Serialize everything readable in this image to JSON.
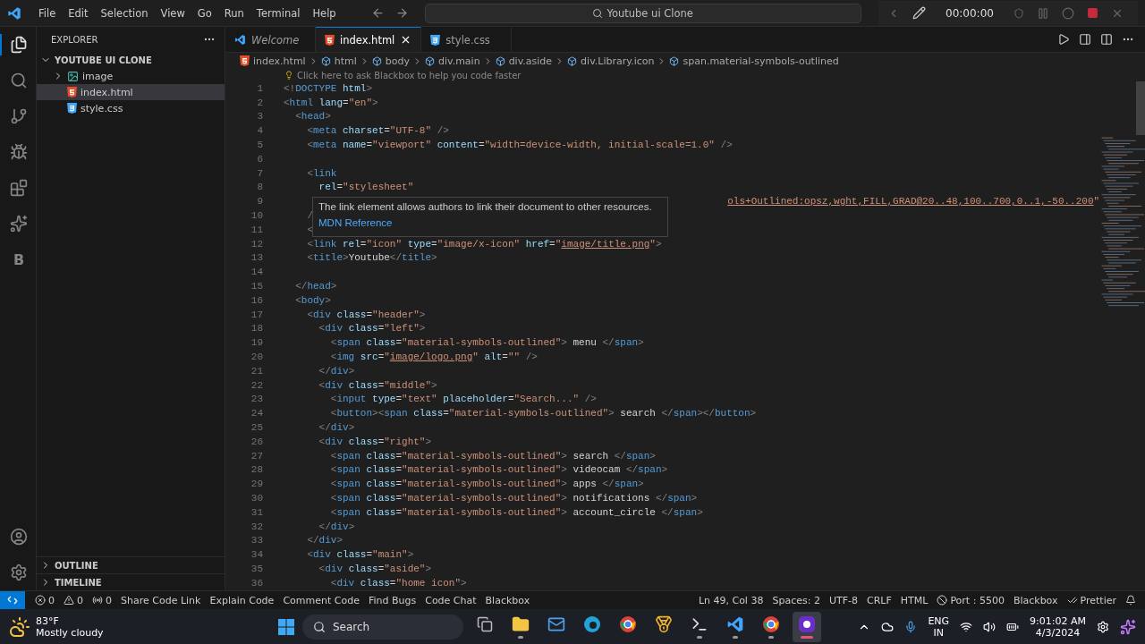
{
  "title_bar": {
    "menu": [
      "File",
      "Edit",
      "Selection",
      "View",
      "Go",
      "Run",
      "Terminal",
      "Help"
    ],
    "command_center": "Youtube ui Clone",
    "recorder": {
      "time": "00:00:00"
    }
  },
  "activity_bar": {
    "items": [
      {
        "kind": "explorer",
        "selected": true
      },
      {
        "kind": "search",
        "selected": false
      },
      {
        "kind": "scm",
        "selected": false
      },
      {
        "kind": "debug",
        "selected": false
      },
      {
        "kind": "extensions",
        "selected": false
      },
      {
        "kind": "ai",
        "selected": false
      },
      {
        "kind": "blackbox",
        "glyph": "B",
        "selected": false
      }
    ],
    "bottom": [
      {
        "kind": "account"
      },
      {
        "kind": "settings"
      }
    ]
  },
  "sidebar": {
    "title": "EXPLORER",
    "tree": [
      {
        "label": "YOUTUBE UI CLONE",
        "kind": "root",
        "expanded": true,
        "selected": false,
        "children": [
          {
            "label": "image",
            "kind": "folder",
            "expanded": false,
            "selected": false
          },
          {
            "label": "index.html",
            "kind": "html",
            "selected": true
          },
          {
            "label": "style.css",
            "kind": "css",
            "selected": false
          }
        ]
      }
    ],
    "sections": [
      {
        "label": "OUTLINE",
        "expanded": false
      },
      {
        "label": "TIMELINE",
        "expanded": false
      }
    ]
  },
  "tabs": [
    {
      "label": "Welcome",
      "kind": "welcome",
      "preview": true,
      "selected": false
    },
    {
      "label": "index.html",
      "kind": "html",
      "preview": false,
      "selected": true
    },
    {
      "label": "style.css",
      "kind": "css",
      "preview": false,
      "selected": false
    }
  ],
  "breadcrumb": [
    {
      "kind": "html",
      "label": "index.html"
    },
    {
      "kind": "element",
      "label": "html"
    },
    {
      "kind": "element",
      "label": "body"
    },
    {
      "kind": "element",
      "label": "div.main"
    },
    {
      "kind": "element",
      "label": "div.aside"
    },
    {
      "kind": "element",
      "label": "div.Library.icon"
    },
    {
      "kind": "element",
      "label": "span.material-symbols-outlined"
    }
  ],
  "hint": "Click here to ask Blackbox to help you code faster",
  "code": [
    {
      "n": "1",
      "tokens": [
        {
          "kind": "p",
          "text": "<!"
        },
        {
          "kind": "tag",
          "text": "DOCTYPE"
        },
        {
          "kind": "attr",
          "text": " html"
        },
        {
          "kind": "p",
          "text": ">"
        }
      ]
    },
    {
      "n": "2",
      "tokens": [
        {
          "kind": "p",
          "text": "<"
        },
        {
          "kind": "tag",
          "text": "html"
        },
        {
          "kind": "attr",
          "text": " lang"
        },
        {
          "kind": "txt",
          "text": "="
        },
        {
          "kind": "str",
          "text": "\"en\""
        },
        {
          "kind": "p",
          "text": ">"
        }
      ]
    },
    {
      "n": "3",
      "tokens": [
        {
          "kind": "p",
          "text": "  <"
        },
        {
          "kind": "tag",
          "text": "head"
        },
        {
          "kind": "p",
          "text": ">"
        }
      ]
    },
    {
      "n": "4",
      "tokens": [
        {
          "kind": "p",
          "text": "    <"
        },
        {
          "kind": "tag",
          "text": "meta"
        },
        {
          "kind": "attr",
          "text": " charset"
        },
        {
          "kind": "txt",
          "text": "="
        },
        {
          "kind": "str",
          "text": "\"UTF-8\""
        },
        {
          "kind": "p",
          "text": " />"
        }
      ]
    },
    {
      "n": "5",
      "tokens": [
        {
          "kind": "p",
          "text": "    <"
        },
        {
          "kind": "tag",
          "text": "meta"
        },
        {
          "kind": "attr",
          "text": " name"
        },
        {
          "kind": "txt",
          "text": "="
        },
        {
          "kind": "str",
          "text": "\"viewport\""
        },
        {
          "kind": "attr",
          "text": " content"
        },
        {
          "kind": "txt",
          "text": "="
        },
        {
          "kind": "str",
          "text": "\"width=device-width, initial-scale=1.0\""
        },
        {
          "kind": "p",
          "text": " />"
        }
      ]
    },
    {
      "n": "6"
    },
    {
      "n": "7",
      "tokens": [
        {
          "kind": "p",
          "text": "    <"
        },
        {
          "kind": "tag",
          "text": "link"
        }
      ]
    },
    {
      "n": "8",
      "tokens": [
        {
          "kind": "attr",
          "text": "      rel"
        },
        {
          "kind": "txt",
          "text": "="
        },
        {
          "kind": "str",
          "text": "\"stylesheet\""
        }
      ]
    },
    {
      "n": "9",
      "kind": "covered",
      "tokens": [
        {
          "kind": "link",
          "text": "ols+Outlined:opsz,wght,FILL,GRAD@20..48,100..700,0..1,-50..200"
        },
        {
          "kind": "str",
          "text": "\""
        }
      ]
    },
    {
      "n": "10",
      "tokens": [
        {
          "kind": "p",
          "text": "    /"
        }
      ]
    },
    {
      "n": "11",
      "tokens": [
        {
          "kind": "p",
          "text": "    <"
        }
      ]
    },
    {
      "n": "12",
      "tokens": [
        {
          "kind": "p",
          "text": "    <"
        },
        {
          "kind": "tag",
          "text": "link"
        },
        {
          "kind": "attr",
          "text": " rel"
        },
        {
          "kind": "txt",
          "text": "="
        },
        {
          "kind": "str",
          "text": "\"icon\""
        },
        {
          "kind": "attr",
          "text": " type"
        },
        {
          "kind": "txt",
          "text": "="
        },
        {
          "kind": "str",
          "text": "\"image/x-icon\""
        },
        {
          "kind": "attr",
          "text": " href"
        },
        {
          "kind": "txt",
          "text": "="
        },
        {
          "kind": "str",
          "text": "\""
        },
        {
          "kind": "link",
          "text": "image/title.png"
        },
        {
          "kind": "str",
          "text": "\""
        },
        {
          "kind": "p",
          "text": ">"
        }
      ]
    },
    {
      "n": "13",
      "tokens": [
        {
          "kind": "p",
          "text": "    <"
        },
        {
          "kind": "tag",
          "text": "title"
        },
        {
          "kind": "p",
          "text": ">"
        },
        {
          "kind": "txt",
          "text": "Youtube"
        },
        {
          "kind": "p",
          "text": "</"
        },
        {
          "kind": "tag",
          "text": "title"
        },
        {
          "kind": "p",
          "text": ">"
        }
      ]
    },
    {
      "n": "14"
    },
    {
      "n": "15",
      "tokens": [
        {
          "kind": "p",
          "text": "  </"
        },
        {
          "kind": "tag",
          "text": "head"
        },
        {
          "kind": "p",
          "text": ">"
        }
      ]
    },
    {
      "n": "16",
      "tokens": [
        {
          "kind": "p",
          "text": "  <"
        },
        {
          "kind": "tag",
          "text": "body"
        },
        {
          "kind": "p",
          "text": ">"
        }
      ]
    },
    {
      "n": "17",
      "tokens": [
        {
          "kind": "p",
          "text": "    <"
        },
        {
          "kind": "tag",
          "text": "div"
        },
        {
          "kind": "attr",
          "text": " class"
        },
        {
          "kind": "txt",
          "text": "="
        },
        {
          "kind": "str",
          "text": "\"header\""
        },
        {
          "kind": "p",
          "text": ">"
        }
      ]
    },
    {
      "n": "18",
      "tokens": [
        {
          "kind": "p",
          "text": "      <"
        },
        {
          "kind": "tag",
          "text": "div"
        },
        {
          "kind": "attr",
          "text": " class"
        },
        {
          "kind": "txt",
          "text": "="
        },
        {
          "kind": "str",
          "text": "\"left\""
        },
        {
          "kind": "p",
          "text": ">"
        }
      ]
    },
    {
      "n": "19",
      "tokens": [
        {
          "kind": "p",
          "text": "        <"
        },
        {
          "kind": "tag",
          "text": "span"
        },
        {
          "kind": "attr",
          "text": " class"
        },
        {
          "kind": "txt",
          "text": "="
        },
        {
          "kind": "str",
          "text": "\"material-symbols-outlined\""
        },
        {
          "kind": "p",
          "text": ">"
        },
        {
          "kind": "txt",
          "text": " menu "
        },
        {
          "kind": "p",
          "text": "</"
        },
        {
          "kind": "tag",
          "text": "span"
        },
        {
          "kind": "p",
          "text": ">"
        }
      ]
    },
    {
      "n": "20",
      "tokens": [
        {
          "kind": "p",
          "text": "        <"
        },
        {
          "kind": "tag",
          "text": "img"
        },
        {
          "kind": "attr",
          "text": " src"
        },
        {
          "kind": "txt",
          "text": "="
        },
        {
          "kind": "str",
          "text": "\""
        },
        {
          "kind": "link",
          "text": "image/logo.png"
        },
        {
          "kind": "str",
          "text": "\""
        },
        {
          "kind": "attr",
          "text": " alt"
        },
        {
          "kind": "txt",
          "text": "="
        },
        {
          "kind": "str",
          "text": "\"\""
        },
        {
          "kind": "p",
          "text": " />"
        }
      ]
    },
    {
      "n": "21",
      "tokens": [
        {
          "kind": "p",
          "text": "      </"
        },
        {
          "kind": "tag",
          "text": "div"
        },
        {
          "kind": "p",
          "text": ">"
        }
      ]
    },
    {
      "n": "22",
      "tokens": [
        {
          "kind": "p",
          "text": "      <"
        },
        {
          "kind": "tag",
          "text": "div"
        },
        {
          "kind": "attr",
          "text": " class"
        },
        {
          "kind": "txt",
          "text": "="
        },
        {
          "kind": "str",
          "text": "\"middle\""
        },
        {
          "kind": "p",
          "text": ">"
        }
      ]
    },
    {
      "n": "23",
      "tokens": [
        {
          "kind": "p",
          "text": "        <"
        },
        {
          "kind": "tag",
          "text": "input"
        },
        {
          "kind": "attr",
          "text": " type"
        },
        {
          "kind": "txt",
          "text": "="
        },
        {
          "kind": "str",
          "text": "\"text\""
        },
        {
          "kind": "attr",
          "text": " placeholder"
        },
        {
          "kind": "txt",
          "text": "="
        },
        {
          "kind": "str",
          "text": "\"Search...\""
        },
        {
          "kind": "p",
          "text": " />"
        }
      ]
    },
    {
      "n": "24",
      "tokens": [
        {
          "kind": "p",
          "text": "        <"
        },
        {
          "kind": "tag",
          "text": "button"
        },
        {
          "kind": "p",
          "text": "><"
        },
        {
          "kind": "tag",
          "text": "span"
        },
        {
          "kind": "attr",
          "text": " class"
        },
        {
          "kind": "txt",
          "text": "="
        },
        {
          "kind": "str",
          "text": "\"material-symbols-outlined\""
        },
        {
          "kind": "p",
          "text": ">"
        },
        {
          "kind": "txt",
          "text": " search "
        },
        {
          "kind": "p",
          "text": "</"
        },
        {
          "kind": "tag",
          "text": "span"
        },
        {
          "kind": "p",
          "text": "></"
        },
        {
          "kind": "tag",
          "text": "button"
        },
        {
          "kind": "p",
          "text": ">"
        }
      ]
    },
    {
      "n": "25",
      "tokens": [
        {
          "kind": "p",
          "text": "      </"
        },
        {
          "kind": "tag",
          "text": "div"
        },
        {
          "kind": "p",
          "text": ">"
        }
      ]
    },
    {
      "n": "26",
      "tokens": [
        {
          "kind": "p",
          "text": "      <"
        },
        {
          "kind": "tag",
          "text": "div"
        },
        {
          "kind": "attr",
          "text": " class"
        },
        {
          "kind": "txt",
          "text": "="
        },
        {
          "kind": "str",
          "text": "\"right\""
        },
        {
          "kind": "p",
          "text": ">"
        }
      ]
    },
    {
      "n": "27",
      "tokens": [
        {
          "kind": "p",
          "text": "        <"
        },
        {
          "kind": "tag",
          "text": "span"
        },
        {
          "kind": "attr",
          "text": " class"
        },
        {
          "kind": "txt",
          "text": "="
        },
        {
          "kind": "str",
          "text": "\"material-symbols-outlined\""
        },
        {
          "kind": "p",
          "text": ">"
        },
        {
          "kind": "txt",
          "text": " search "
        },
        {
          "kind": "p",
          "text": "</"
        },
        {
          "kind": "tag",
          "text": "span"
        },
        {
          "kind": "p",
          "text": ">"
        }
      ]
    },
    {
      "n": "28",
      "tokens": [
        {
          "kind": "p",
          "text": "        <"
        },
        {
          "kind": "tag",
          "text": "span"
        },
        {
          "kind": "attr",
          "text": " class"
        },
        {
          "kind": "txt",
          "text": "="
        },
        {
          "kind": "str",
          "text": "\"material-symbols-outlined\""
        },
        {
          "kind": "p",
          "text": ">"
        },
        {
          "kind": "txt",
          "text": " videocam "
        },
        {
          "kind": "p",
          "text": "</"
        },
        {
          "kind": "tag",
          "text": "span"
        },
        {
          "kind": "p",
          "text": ">"
        }
      ]
    },
    {
      "n": "29",
      "tokens": [
        {
          "kind": "p",
          "text": "        <"
        },
        {
          "kind": "tag",
          "text": "span"
        },
        {
          "kind": "attr",
          "text": " class"
        },
        {
          "kind": "txt",
          "text": "="
        },
        {
          "kind": "str",
          "text": "\"material-symbols-outlined\""
        },
        {
          "kind": "p",
          "text": ">"
        },
        {
          "kind": "txt",
          "text": " apps "
        },
        {
          "kind": "p",
          "text": "</"
        },
        {
          "kind": "tag",
          "text": "span"
        },
        {
          "kind": "p",
          "text": ">"
        }
      ]
    },
    {
      "n": "30",
      "tokens": [
        {
          "kind": "p",
          "text": "        <"
        },
        {
          "kind": "tag",
          "text": "span"
        },
        {
          "kind": "attr",
          "text": " class"
        },
        {
          "kind": "txt",
          "text": "="
        },
        {
          "kind": "str",
          "text": "\"material-symbols-outlined\""
        },
        {
          "kind": "p",
          "text": ">"
        },
        {
          "kind": "txt",
          "text": " notifications "
        },
        {
          "kind": "p",
          "text": "</"
        },
        {
          "kind": "tag",
          "text": "span"
        },
        {
          "kind": "p",
          "text": ">"
        }
      ]
    },
    {
      "n": "31",
      "tokens": [
        {
          "kind": "p",
          "text": "        <"
        },
        {
          "kind": "tag",
          "text": "span"
        },
        {
          "kind": "attr",
          "text": " class"
        },
        {
          "kind": "txt",
          "text": "="
        },
        {
          "kind": "str",
          "text": "\"material-symbols-outlined\""
        },
        {
          "kind": "p",
          "text": ">"
        },
        {
          "kind": "txt",
          "text": " account_circle "
        },
        {
          "kind": "p",
          "text": "</"
        },
        {
          "kind": "tag",
          "text": "span"
        },
        {
          "kind": "p",
          "text": ">"
        }
      ]
    },
    {
      "n": "32",
      "tokens": [
        {
          "kind": "p",
          "text": "      </"
        },
        {
          "kind": "tag",
          "text": "div"
        },
        {
          "kind": "p",
          "text": ">"
        }
      ]
    },
    {
      "n": "33",
      "tokens": [
        {
          "kind": "p",
          "text": "    </"
        },
        {
          "kind": "tag",
          "text": "div"
        },
        {
          "kind": "p",
          "text": ">"
        }
      ]
    },
    {
      "n": "34",
      "tokens": [
        {
          "kind": "p",
          "text": "    <"
        },
        {
          "kind": "tag",
          "text": "div"
        },
        {
          "kind": "attr",
          "text": " class"
        },
        {
          "kind": "txt",
          "text": "="
        },
        {
          "kind": "str",
          "text": "\"main\""
        },
        {
          "kind": "p",
          "text": ">"
        }
      ]
    },
    {
      "n": "35",
      "tokens": [
        {
          "kind": "p",
          "text": "      <"
        },
        {
          "kind": "tag",
          "text": "div"
        },
        {
          "kind": "attr",
          "text": " class"
        },
        {
          "kind": "txt",
          "text": "="
        },
        {
          "kind": "str",
          "text": "\"aside\""
        },
        {
          "kind": "p",
          "text": ">"
        }
      ]
    },
    {
      "n": "36",
      "tokens": [
        {
          "kind": "p",
          "text": "        <"
        },
        {
          "kind": "tag",
          "text": "div"
        },
        {
          "kind": "attr",
          "text": " class"
        },
        {
          "kind": "txt",
          "text": "="
        },
        {
          "kind": "str",
          "text": "\"home icon\""
        },
        {
          "kind": "p",
          "text": ">"
        }
      ]
    }
  ],
  "hover_tooltip": {
    "text": "The link element allows authors to link their document to other resources.",
    "link": "MDN Reference"
  },
  "status_bar": {
    "left": [
      {
        "kind": "errors",
        "text": "0"
      },
      {
        "kind": "warnings",
        "text": "0"
      },
      {
        "kind": "broadcast",
        "text": "0"
      },
      {
        "kind": "plain",
        "text": "Share Code Link"
      },
      {
        "kind": "plain",
        "text": "Explain Code"
      },
      {
        "kind": "plain",
        "text": "Comment Code"
      },
      {
        "kind": "plain",
        "text": "Find Bugs"
      },
      {
        "kind": "plain",
        "text": "Code Chat"
      },
      {
        "kind": "plain",
        "text": "Blackbox"
      }
    ],
    "right": [
      {
        "kind": "plain",
        "text": "Ln 49, Col 38"
      },
      {
        "kind": "plain",
        "text": "Spaces: 2"
      },
      {
        "kind": "plain",
        "text": "UTF-8"
      },
      {
        "kind": "plain",
        "text": "CRLF"
      },
      {
        "kind": "plain",
        "text": "HTML"
      },
      {
        "kind": "port",
        "text": "Port : 5500"
      },
      {
        "kind": "plain",
        "text": "Blackbox"
      },
      {
        "kind": "prettier",
        "text": "Prettier"
      },
      {
        "kind": "bell"
      }
    ]
  },
  "taskbar": {
    "weather": {
      "temp": "83°F",
      "condition": "Mostly cloudy"
    },
    "search": "Search",
    "apps": [
      {
        "kind": "taskview",
        "running": false,
        "selected": false
      },
      {
        "kind": "explorer",
        "running": true,
        "selected": false
      },
      {
        "kind": "mail",
        "running": false,
        "selected": false
      },
      {
        "kind": "edge",
        "running": false,
        "selected": false
      },
      {
        "kind": "chrome",
        "running": false,
        "selected": false
      },
      {
        "kind": "medal",
        "running": false,
        "selected": false
      },
      {
        "kind": "terminal",
        "running": true,
        "selected": false
      },
      {
        "kind": "vscode",
        "running": true,
        "selected": false
      },
      {
        "kind": "chrome",
        "running": true,
        "selected": false
      },
      {
        "kind": "recorder",
        "running": true,
        "selected": true
      }
    ],
    "language": [
      "ENG",
      "IN"
    ],
    "time": "9:01:02 AM",
    "date": "4/3/2024"
  }
}
